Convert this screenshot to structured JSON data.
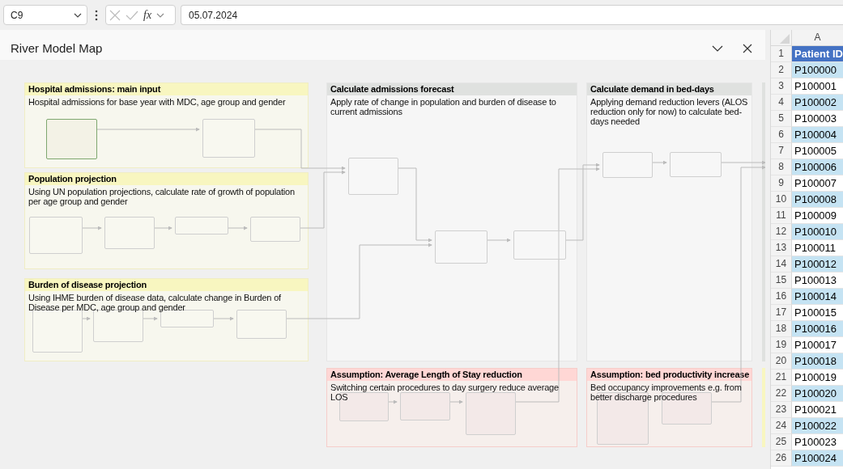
{
  "formula_bar": {
    "name_box": "C9",
    "function_label": "fx",
    "formula": "05.07.2024"
  },
  "panel": {
    "title": "River Model Map"
  },
  "groups": [
    {
      "kind": "input",
      "title": "Hospital admissions: main input",
      "description": "Hospital admissions for base year with MDC, age group and gender",
      "nodes": [
        {
          "selected": true
        },
        {
          "selected": false
        }
      ]
    },
    {
      "kind": "input",
      "title": "Population projection",
      "description": "Using UN population projections, calculate rate of growth of population per age group and gender",
      "nodes": [
        {
          "selected": false
        },
        {
          "selected": false
        },
        {
          "selected": false
        },
        {
          "selected": false
        }
      ]
    },
    {
      "kind": "input",
      "title": "Burden of disease projection",
      "description": "Using IHME burden of disease data, calculate change in Burden of Disease per MDC, age group and gender",
      "nodes": [
        {
          "selected": false
        },
        {
          "selected": false
        },
        {
          "selected": false
        },
        {
          "selected": false
        }
      ]
    },
    {
      "kind": "process",
      "title": "Calculate admissions forecast",
      "description": "Apply rate of change in population and burden of disease to current admissions",
      "nodes": [
        {
          "selected": false
        },
        {
          "selected": false
        },
        {
          "selected": false
        }
      ]
    },
    {
      "kind": "process",
      "title": "Calculate demand in bed-days",
      "description": "Applying demand reduction levers (ALOS reduction only for now) to calculate bed-days needed",
      "nodes": [
        {
          "selected": false
        },
        {
          "selected": false
        }
      ]
    },
    {
      "kind": "assumption",
      "title": "Assumption: Average Length of Stay reduction",
      "description": "Switching certain procedures to day surgery reduce average LOS",
      "nodes": [
        {
          "selected": false
        },
        {
          "selected": false
        },
        {
          "selected": false
        }
      ]
    },
    {
      "kind": "assumption",
      "title": "Assumption: bed productivity increase",
      "description": "Bed occupancy improvements e.g. from better discharge procedures",
      "nodes": [
        {
          "selected": false
        },
        {
          "selected": false
        }
      ]
    }
  ],
  "sheet": {
    "column": "A",
    "rows": [
      {
        "number": "1",
        "value": "Patient ID",
        "kind": "header"
      },
      {
        "number": "2",
        "value": "P100000",
        "kind": "data"
      },
      {
        "number": "3",
        "value": "P100001",
        "kind": "data"
      },
      {
        "number": "4",
        "value": "P100002",
        "kind": "data"
      },
      {
        "number": "5",
        "value": "P100003",
        "kind": "data"
      },
      {
        "number": "6",
        "value": "P100004",
        "kind": "data"
      },
      {
        "number": "7",
        "value": "P100005",
        "kind": "data"
      },
      {
        "number": "8",
        "value": "P100006",
        "kind": "data"
      },
      {
        "number": "9",
        "value": "P100007",
        "kind": "data"
      },
      {
        "number": "10",
        "value": "P100008",
        "kind": "data"
      },
      {
        "number": "11",
        "value": "P100009",
        "kind": "data"
      },
      {
        "number": "12",
        "value": "P100010",
        "kind": "data"
      },
      {
        "number": "13",
        "value": "P100011",
        "kind": "data"
      },
      {
        "number": "14",
        "value": "P100012",
        "kind": "data"
      },
      {
        "number": "15",
        "value": "P100013",
        "kind": "data"
      },
      {
        "number": "16",
        "value": "P100014",
        "kind": "data"
      },
      {
        "number": "17",
        "value": "P100015",
        "kind": "data"
      },
      {
        "number": "18",
        "value": "P100016",
        "kind": "data"
      },
      {
        "number": "19",
        "value": "P100017",
        "kind": "data"
      },
      {
        "number": "20",
        "value": "P100018",
        "kind": "data"
      },
      {
        "number": "21",
        "value": "P100019",
        "kind": "data"
      },
      {
        "number": "22",
        "value": "P100020",
        "kind": "data"
      },
      {
        "number": "23",
        "value": "P100021",
        "kind": "data"
      },
      {
        "number": "24",
        "value": "P100022",
        "kind": "data"
      },
      {
        "number": "25",
        "value": "P100023",
        "kind": "data"
      },
      {
        "number": "26",
        "value": "P100024",
        "kind": "data"
      }
    ]
  }
}
